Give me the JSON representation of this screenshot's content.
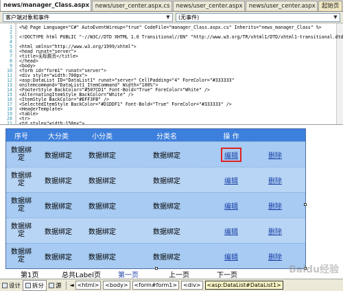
{
  "tabs": [
    {
      "label": "news/manager_Class.aspx",
      "active": true
    },
    {
      "label": "news/user_center.aspx.cs",
      "active": false
    },
    {
      "label": "news/user_center.aspx",
      "active": false
    },
    {
      "label": "news/user_center.aspx",
      "active": false
    },
    {
      "label": "起始页",
      "active": false
    }
  ],
  "combos": {
    "object_value": "客户端对象和事件",
    "event_value": "(无事件)"
  },
  "code_lines": [
    {
      "n": "1",
      "text": "<%@ Page Language=\"C#\" AutoEventWireup=\"true\" CodeFile=\"manager_Class.aspx.cs\" Inherits=\"news_manager_Class\" %>"
    },
    {
      "n": "2",
      "text": ""
    },
    {
      "n": "3",
      "text": "<!DOCTYPE html PUBLIC \"-//W3C//DTD XHTML 1.0 Transitional//EN\" \"http://www.w3.org/TR/xhtml1/DTD/xhtml1-transitional.dtd\">"
    },
    {
      "n": "4",
      "text": ""
    },
    {
      "n": "5",
      "text": "<html xmlns=\"http://www.w3.org/1999/xhtml\">"
    },
    {
      "n": "6",
      "text": "<head runat=\"server\">"
    },
    {
      "n": "7",
      "text": "    <title>无标题页</title>"
    },
    {
      "n": "8",
      "text": "</head>"
    },
    {
      "n": "9",
      "text": "<body>"
    },
    {
      "n": "10",
      "text": "    <form id=\"form1\" runat=\"server\">"
    },
    {
      "n": "11",
      "text": "    <div style=\"width:700px\">"
    },
    {
      "n": "12",
      "text": "        <asp:DataList ID=\"DataList1\" runat=\"server\" CellPadding=\"4\" ForeColor=\"#333333\""
    },
    {
      "n": "13",
      "text": "            onitemcommand=\"DataList1_ItemCommand\" Width=\"100%\">"
    },
    {
      "n": "14",
      "text": "            <FooterStyle BackColor=\"#507CD1\" Font-Bold=\"True\" ForeColor=\"White\" />"
    },
    {
      "n": "15",
      "text": "            <AlternatingItemStyle BackColor=\"White\" />"
    },
    {
      "n": "16",
      "text": "            <ItemStyle BackColor=\"#EFF3FB\" />"
    },
    {
      "n": "17",
      "text": "            <SelectedItemStyle BackColor=\"#D1DDF1\" Font-Bold=\"True\" ForeColor=\"#333333\" />"
    },
    {
      "n": "18",
      "text": "            <HeaderTemplate>"
    },
    {
      "n": "19",
      "text": "                <table>"
    },
    {
      "n": "20",
      "text": "                    <tr>"
    },
    {
      "n": "21",
      "text": "                        <td style=\"width:150px\">"
    }
  ],
  "datalist": {
    "headers": {
      "id": "序号",
      "big": "大分类",
      "small": "小分类",
      "name": "分类名",
      "ops": "操 作"
    },
    "bound_text": "数据绑定",
    "edit_label": "编辑",
    "delete_label": "删除",
    "rows": [
      {
        "id": "数据绑定",
        "big": "数据绑定",
        "small": "数据绑定",
        "name": "数据绑定",
        "edit": "编辑",
        "delete": "删除"
      },
      {
        "id": "数据绑定",
        "big": "数据绑定",
        "small": "数据绑定",
        "name": "数据绑定",
        "edit": "编辑",
        "delete": "删除"
      },
      {
        "id": "数据绑定",
        "big": "数据绑定",
        "small": "数据绑定",
        "name": "数据绑定",
        "edit": "编辑",
        "delete": "删除"
      },
      {
        "id": "数据绑定",
        "big": "数据绑定",
        "small": "数据绑定",
        "name": "数据绑定",
        "edit": "编辑",
        "delete": "删除"
      },
      {
        "id": "数据绑定",
        "big": "数据绑定",
        "small": "数据绑定",
        "name": "数据绑定",
        "edit": "编辑",
        "delete": "删除"
      }
    ]
  },
  "pager": {
    "first": "第1页",
    "total": "总共Label页",
    "first_page": "第一页",
    "prev": "上一页",
    "next": "下一页"
  },
  "statusbar": {
    "design_label": "设计",
    "split_label": "拆分",
    "source_label": "源",
    "crumbs": [
      "<html>",
      "<body>",
      "<form#form1>",
      "<div>",
      "<asp:DataList#DataList1>"
    ]
  },
  "watermark": "Baidu经验",
  "colors": {
    "header_bg": "#3d7fdc",
    "row_bg": "#a7cbf2",
    "highlight": "#e02020"
  }
}
